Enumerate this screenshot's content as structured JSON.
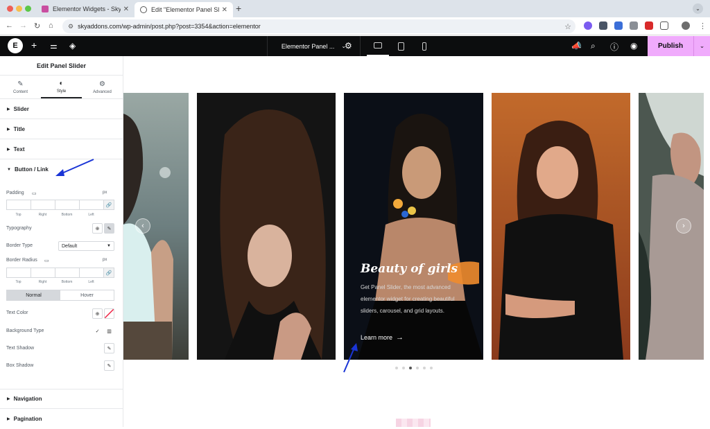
{
  "browser": {
    "tabs": [
      {
        "title": "Elementor Widgets - Sky Addo",
        "active": false
      },
      {
        "title": "Edit \"Elementor Panel Slider\"",
        "active": true
      }
    ],
    "url": "skyaddons.com/wp-admin/post.php?post=3354&action=elementor"
  },
  "editor": {
    "document_title": "Elementor Panel ...",
    "publish_label": "Publish"
  },
  "panel": {
    "title": "Edit Panel Slider",
    "tabs": [
      {
        "label": "Content",
        "icon": "pencil-icon"
      },
      {
        "label": "Style",
        "icon": "half-circle-icon"
      },
      {
        "label": "Advanced",
        "icon": "gear-icon"
      }
    ],
    "sections": [
      "Slider",
      "Title",
      "Text",
      "Button / Link"
    ],
    "footer_sections": [
      "Navigation",
      "Pagination"
    ],
    "controls": {
      "padding_label": "Padding",
      "padding_unit": "px",
      "dimension_labels": [
        "Top",
        "Right",
        "Bottom",
        "Left"
      ],
      "typography_label": "Typography",
      "border_type_label": "Border Type",
      "border_type_value": "Default",
      "border_radius_label": "Border Radius",
      "border_radius_unit": "px",
      "state_tabs": [
        "Normal",
        "Hover"
      ],
      "text_color_label": "Text Color",
      "background_type_label": "Background Type",
      "text_shadow_label": "Text Shadow",
      "box_shadow_label": "Box Shadow"
    }
  },
  "slider": {
    "active_slide": {
      "title": "Beauty of girls",
      "description": "Get Panel Slider, the most advanced elementor widget for creating beautiful sliders, carousel, and grid layouts.",
      "link_label": "Learn more"
    },
    "pagination": {
      "count": 6,
      "active": 3
    }
  },
  "colors": {
    "accent": "#f0abfc",
    "topbar": "#0c0d0e",
    "annotation_arrow": "#1a35d6"
  }
}
